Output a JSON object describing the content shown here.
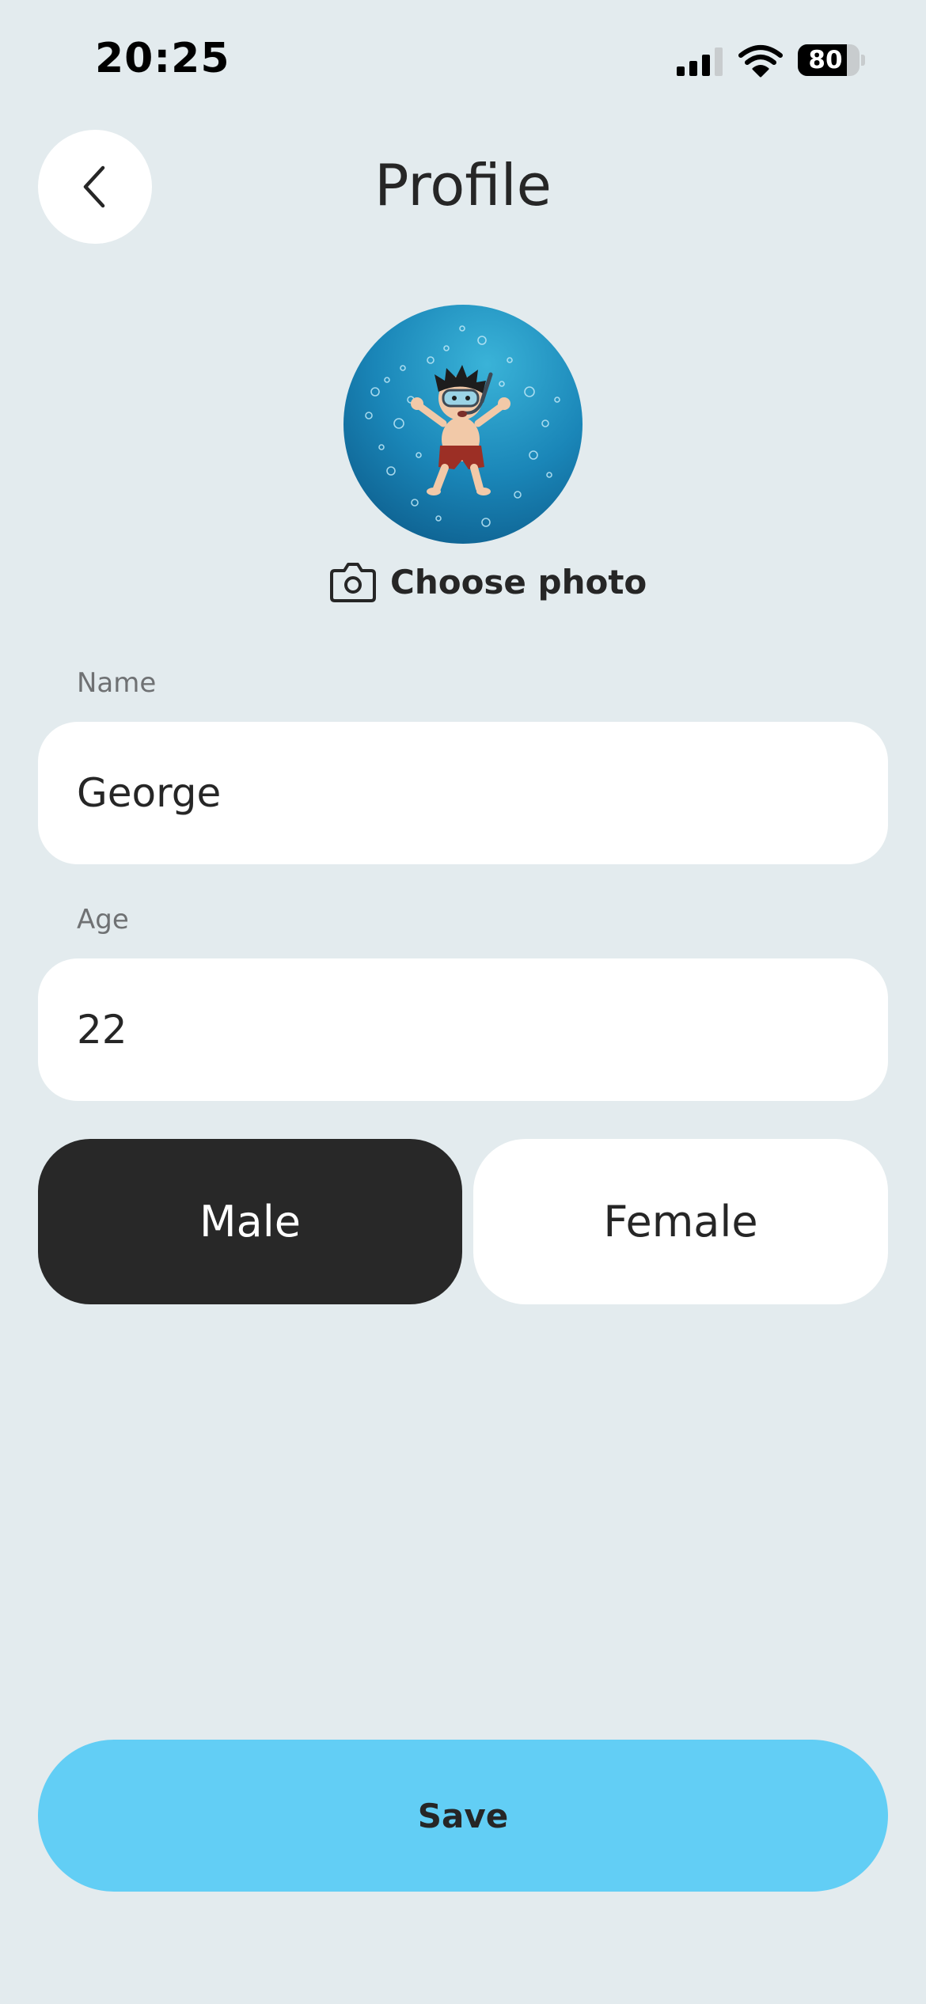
{
  "status_bar": {
    "time": "20:25",
    "battery_level": "80",
    "battery_fraction": 0.8
  },
  "header": {
    "title": "Profile",
    "back_icon": "chevron-left-icon"
  },
  "avatar": {
    "icon": "avatar-illustration-underwater-snorkeler"
  },
  "choose_photo": {
    "label": "Choose photo",
    "icon": "camera-icon"
  },
  "form": {
    "name": {
      "label": "Name",
      "value": "George"
    },
    "age": {
      "label": "Age",
      "value": "22"
    }
  },
  "gender": {
    "options": [
      {
        "label": "Male",
        "selected": true
      },
      {
        "label": "Female",
        "selected": false
      }
    ]
  },
  "save_label": "Save",
  "colors": {
    "background": "#e3ebee",
    "selected": "#282828",
    "accent": "#62cef5"
  }
}
